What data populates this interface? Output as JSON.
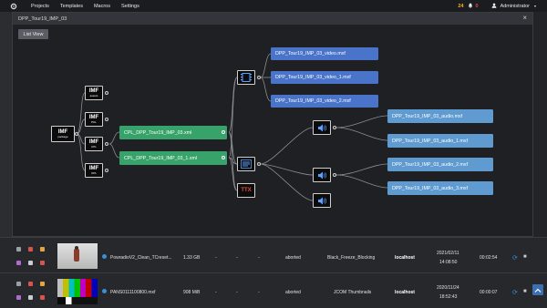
{
  "topbar": {
    "nav": [
      "Projects",
      "Templates",
      "Macros",
      "Settings"
    ],
    "badge_warn": "24",
    "badge_alert": "0",
    "user": "Administrator"
  },
  "modal": {
    "title": "DPP_Tour19_IMP_03",
    "list_view_label": "List View"
  },
  "graph": {
    "root": {
      "big": "IMF",
      "small": "package"
    },
    "imf_nodes": [
      {
        "big": "IMF",
        "small": "assets"
      },
      {
        "big": "IMF",
        "small": "PKL"
      },
      {
        "big": "IMF",
        "small": "CPL"
      },
      {
        "big": "IMF",
        "small": "OPL"
      }
    ],
    "cpls": [
      "CPL_DPP_Tour19_IMP_03.xml",
      "CPL_DPP_Tour19_IMP_03_1.xml"
    ],
    "videos": [
      "DPP_Tour19_IMP_03_video.mxf",
      "DPP_Tour19_IMP_03_video_1.mxf",
      "DPP_Tour19_IMP_03_video_2.mxf"
    ],
    "audios": [
      "DPP_Tour19_IMP_03_audio.mxf",
      "DPP_Tour19_IMP_03_audio_1.mxf",
      "DPP_Tour19_IMP_03_audio_2.mxf",
      "DPP_Tour19_IMP_03_audio_3.mxf"
    ],
    "ttx_label": "TTX",
    "icons": {
      "video": "film-icon",
      "subtitle": "subtitle-icon",
      "audio": "speaker-icon"
    }
  },
  "rows": [
    {
      "name": "PowradioV2_Clean_TCreset...",
      "size": "1.33 GB",
      "d1": "-",
      "d2": "-",
      "d3": "-",
      "status": "aborted",
      "workflow": "Black_Freeze_Blocking",
      "host": "localhost",
      "date": "2021/02/11",
      "time": "14:08:50",
      "duration": "00:02:54"
    },
    {
      "name": "PANS0111100800.mxf",
      "size": "908 MiB",
      "d1": "-",
      "d2": "-",
      "d3": "-",
      "status": "aborted",
      "workflow": "JCOM Thumbnails",
      "host": "localhost",
      "date": "2020/11/24",
      "time": "18:52:43",
      "duration": "00:00:07"
    }
  ],
  "colors": {
    "blue": "#4a74c9",
    "light_blue": "#5f9bd0",
    "green": "#37a36a",
    "accent": "#3b8fd6"
  }
}
